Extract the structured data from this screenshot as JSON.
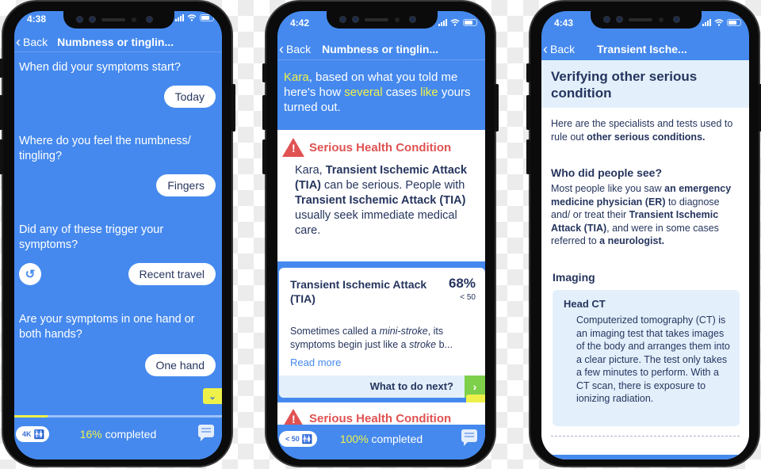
{
  "phones": [
    {
      "status_time": "4:38",
      "back_label": "Back",
      "nav_title": "Numbness or tinglin...",
      "conversation": [
        {
          "question": "When did your symptoms start?",
          "answer": "Today"
        },
        {
          "question": "Where do you feel the numbness/ tingling?",
          "answer": "Fingers"
        },
        {
          "question": "Did any of these trigger your symptoms?",
          "answer": "Recent travel"
        },
        {
          "question": "Are your symptoms in one hand or both hands?",
          "answer": "One hand"
        }
      ],
      "undo_icon": "↺",
      "scroll_down_icon": "⌄",
      "progress_fraction": 0.16,
      "footer": {
        "count_label": "4K",
        "people_icon": "👥",
        "percent": "16%",
        "completed_label": "completed"
      }
    },
    {
      "status_time": "4:42",
      "back_label": "Back",
      "nav_title": "Numbness or tinglin...",
      "intro": {
        "name": "Kara",
        "t1": ", based on what you told me here's how ",
        "w1": "several",
        "t2": " cases ",
        "w2": "like",
        "t3": " yours turned out."
      },
      "warning": {
        "title": "Serious Health Condition",
        "body_prefix": "Kara, ",
        "body_bold1": "Transient Ischemic Attack (TIA)",
        "body_mid": " can be serious. People with ",
        "body_bold2": "Transient Ischemic Attack (TIA)",
        "body_suffix": " usually seek immediate medical care."
      },
      "condition_card": {
        "name": "Transient Ischemic Attack (TIA)",
        "percent": "68%",
        "sub": "< 50",
        "desc_a": "Sometimes called a ",
        "desc_em1": "mini-stroke",
        "desc_b": ", its symptoms begin just like a ",
        "desc_em2": "stroke",
        "desc_c": " b...",
        "read_more": "Read more",
        "next_label": "What to do next?",
        "next_icon": "›"
      },
      "warning2_title": "Serious Health Condition",
      "footer": {
        "count_label": "< 50",
        "people_icon": "👥",
        "percent": "100%",
        "completed_label": "completed"
      }
    },
    {
      "status_time": "4:43",
      "back_label": "Back",
      "nav_title": "Transient Ische...",
      "heading": "Verifying other serious condition",
      "intro_a": "Here are the specialists and tests used to rule out ",
      "intro_bold": "other serious conditions.",
      "who_heading": "Who did people see?",
      "who_a": "Most people like you saw ",
      "who_b1": "an emergency medicine physician (ER)",
      "who_c": " to diagnose and/ or treat their ",
      "who_b2": "Transient Ischemic Attack (TIA)",
      "who_d": ", and were in some cases referred to ",
      "who_b3": "a neurologist.",
      "imaging_heading": "Imaging",
      "test": {
        "title": "Head CT",
        "description": "Computerized tomography (CT) is an imaging test that takes images of the body and arranges them into a clear picture. The test only takes a few minutes to perform. With a CT scan, there is exposure to ionizing radiation."
      }
    }
  ],
  "colors": {
    "primary": "#4589ee",
    "accent_yellow": "#eef14a",
    "danger": "#e05252",
    "text_dark": "#26355e",
    "success": "#7ed04b",
    "light_blue": "#e3f0fc"
  }
}
